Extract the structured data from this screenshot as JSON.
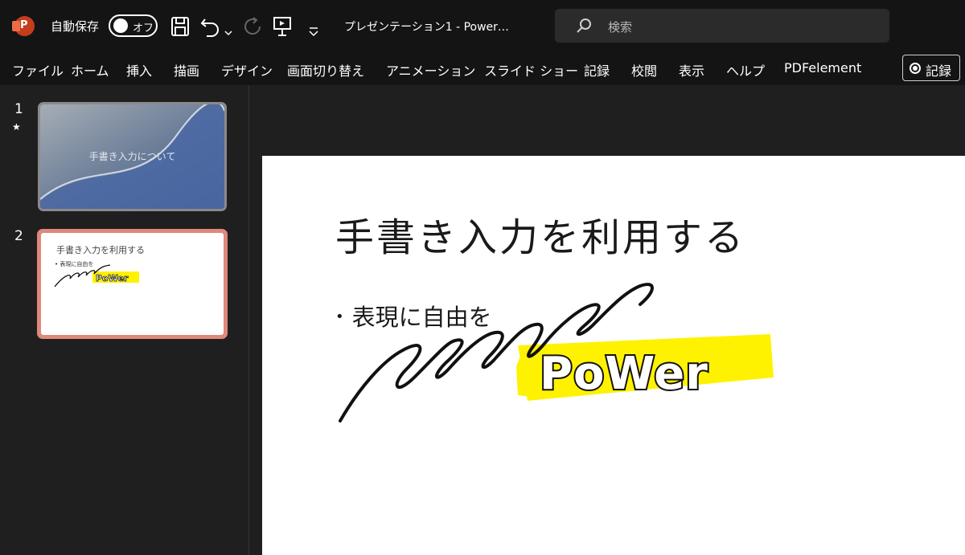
{
  "app": {
    "logo_letter": "P",
    "icon": "powerpoint-logo-icon"
  },
  "titlebar": {
    "autosave_label": "自動保存",
    "autosave_toggle": "オフ",
    "doc_title": "プレゼンテーション1  -  Power…",
    "search_placeholder": "検索",
    "icons": [
      "save-icon",
      "undo-icon",
      "undo-dropdown-icon",
      "redo-icon",
      "present-from-start-icon",
      "customize-toolbar-icon",
      "search-icon"
    ]
  },
  "ribbon": {
    "tabs": [
      "ファイル",
      "ホーム",
      "挿入",
      "描画",
      "デザイン",
      "画面切り替え",
      "アニメーション",
      "スライド ショー",
      "記録",
      "校閲",
      "表示",
      "ヘルプ",
      "PDFelement"
    ],
    "record_button": "記録"
  },
  "thumbnails": [
    {
      "number": "1",
      "title": "手書き入力について",
      "has_transition_icon": true
    },
    {
      "number": "2",
      "title": "手書き入力を利用する",
      "bullet": "• 表現に自由を",
      "selected": true
    }
  ],
  "slide": {
    "title": "手書き入力を利用する",
    "bullet": "表現に自由を",
    "bullet_marker": "•",
    "ink_text": "PoWer",
    "highlight_color": "#fff200"
  }
}
